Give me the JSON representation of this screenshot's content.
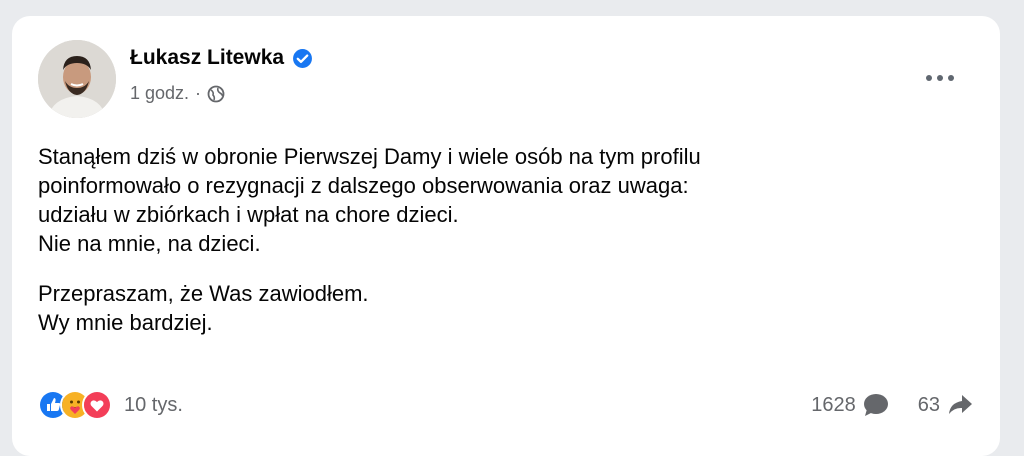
{
  "post": {
    "author": "Łukasz Litewka",
    "time": "1 godz.",
    "separator": "·",
    "paragraphs": [
      "Stanąłem dziś w obronie Pierwszej Damy i wiele osób na tym profilu",
      "poinformowało o rezygnacji z dalszego obserwowania oraz uwaga:",
      "udziału w zbiórkach i wpłat na chore dzieci.",
      "Nie na mnie, na dzieci.",
      "Przepraszam, że Was zawiodłem.",
      "Wy mnie bardziej."
    ],
    "reactions_count": "10 tys.",
    "comments_count": "1628",
    "shares_count": "63"
  },
  "icons": {
    "verified": "verified-badge-icon",
    "audience": "globe-icon",
    "more": "more-options-icon",
    "reactions": [
      "like-icon",
      "care-icon",
      "love-icon"
    ],
    "comment": "comment-icon",
    "share": "share-icon"
  },
  "colors": {
    "verified": "#1877f2",
    "like": "#1877f2",
    "care": "#f7b125",
    "love": "#f33e58",
    "secondary_text": "#65676b"
  }
}
